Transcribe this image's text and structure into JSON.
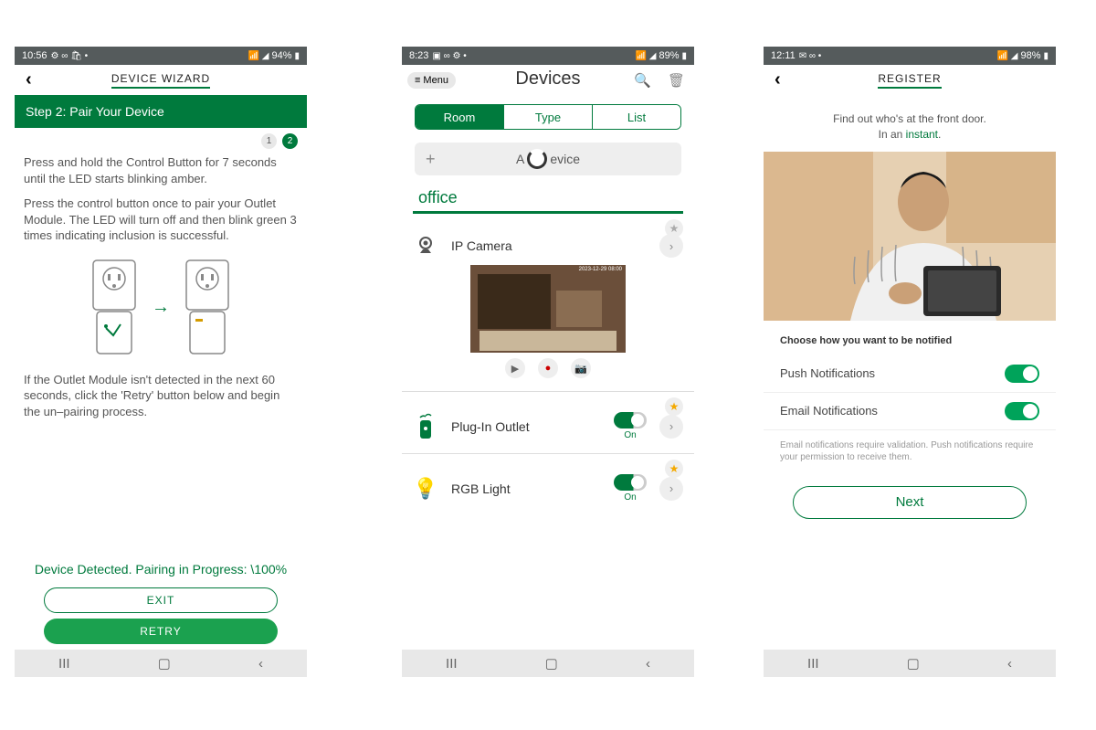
{
  "phone1": {
    "status": {
      "time": "10:56",
      "battery": "94%",
      "left_icons": "⚙ ∞ 🛍 •",
      "right_icons": "📶 ⏶ ▮"
    },
    "header": "DEVICE WIZARD",
    "step_banner": "Step 2: Pair Your Device",
    "dots": [
      "1",
      "2"
    ],
    "active_dot": 1,
    "instructions_1": "Press and hold the Control Button for 7 seconds until the LED starts blinking amber.",
    "instructions_2": "Press the control button once to pair your Outlet Module. The LED will turn off and then blink green 3 times indicating inclusion is successful.",
    "instructions_3": "If the Outlet Module isn't detected in the next 60 seconds, click the 'Retry' button below and begin the un–pairing process.",
    "status_line": "Device Detected. Pairing in Progress: \\100%",
    "exit": "EXIT",
    "retry": "RETRY"
  },
  "phone2": {
    "status": {
      "time": "8:23",
      "battery": "89%",
      "left_icons": "▣ ∞ ⚙ •",
      "right_icons": "📶 ⏶ ▮"
    },
    "menu": "Menu",
    "title": "Devices",
    "seg": [
      "Room",
      "Type",
      "List"
    ],
    "seg_active": 0,
    "add_device_left": "A",
    "add_device_right": "evice",
    "room": "office",
    "devices": [
      {
        "name": "IP Camera",
        "favorite": false,
        "icon": "camera",
        "toggle": null
      },
      {
        "name": "Plug-In Outlet",
        "favorite": true,
        "icon": "plug",
        "toggle": "On"
      },
      {
        "name": "RGB Light",
        "favorite": true,
        "icon": "bulb",
        "toggle": "On"
      }
    ]
  },
  "phone3": {
    "status": {
      "time": "12:11",
      "battery": "98%",
      "left_icons": "✉ ∞ •",
      "right_icons": "📶 ⏶ ▮"
    },
    "header": "REGISTER",
    "intro_line1": "Find out who's at the front door.",
    "intro_line2a": "In an ",
    "intro_line2b": "instant",
    "intro_line2c": ".",
    "section_title": "Choose how you want to be notified",
    "push_label": "Push Notifications",
    "email_label": "Email Notifications",
    "fine_print": "Email notifications require validation. Push notifications require your permission to receive them.",
    "next": "Next"
  },
  "nav": {
    "recents": "III",
    "home": "▢",
    "back": "‹"
  }
}
